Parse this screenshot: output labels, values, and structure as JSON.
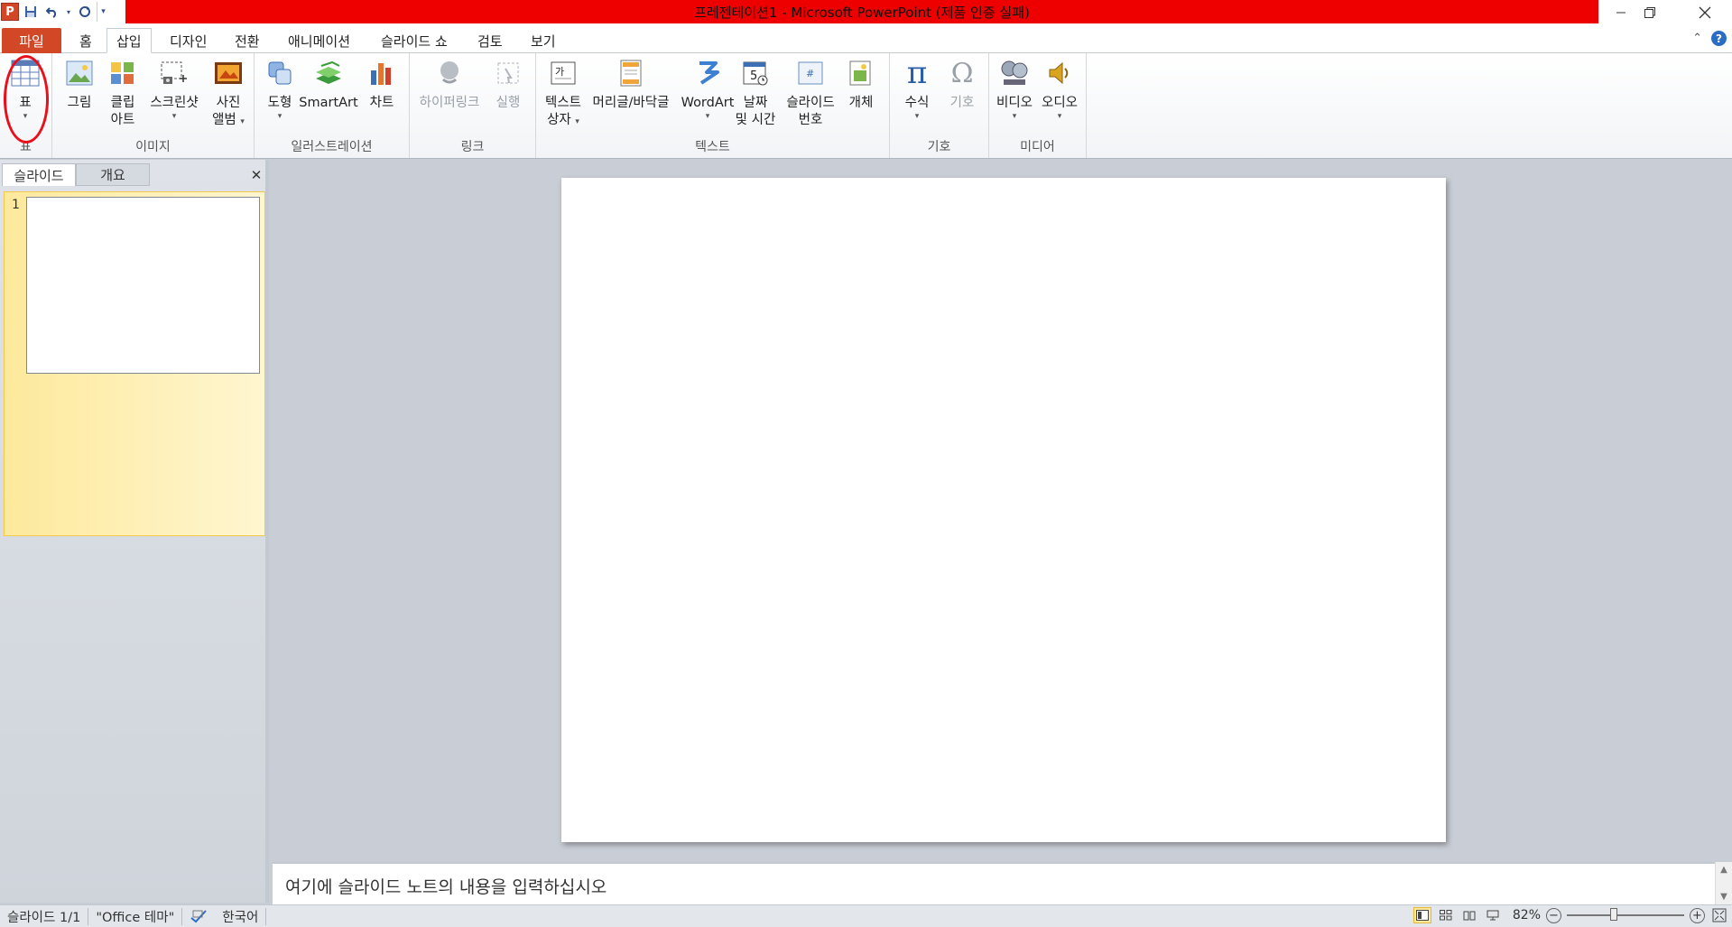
{
  "titlebar": {
    "title": "프레젠테이션1  -  Microsoft PowerPoint (제품 인증 실패)",
    "accent_color": "#ee0000"
  },
  "qat": {
    "app_icon": "powerpoint-icon",
    "app_letter": "P",
    "buttons": [
      "save-icon",
      "undo-icon",
      "redo-icon",
      "customize-dropdown-icon"
    ]
  },
  "tabs": {
    "file": "파일",
    "home": "홈",
    "insert": "삽입",
    "design": "디자인",
    "transitions": "전환",
    "animations": "애니메이션",
    "slideshow": "슬라이드 쇼",
    "review": "검토",
    "view": "보기",
    "active": "삽입"
  },
  "ribbon": {
    "groups": {
      "table": "표",
      "images": "이미지",
      "illustrations": "일러스트레이션",
      "links": "링크",
      "text": "텍스트",
      "symbols": "기호",
      "media": "미디어"
    },
    "buttons": {
      "table": "표",
      "picture": "그림",
      "clipart_1": "클립",
      "clipart_2": "아트",
      "screenshot": "스크린샷",
      "album_1": "사진",
      "album_2": "앨범",
      "shapes": "도형",
      "smartart": "SmartArt",
      "chart": "차트",
      "hyperlink": "하이퍼링크",
      "action": "실행",
      "textbox_1": "텍스트",
      "textbox_2": "상자",
      "headerfooter": "머리글/바닥글",
      "wordart": "WordArt",
      "datetime_1": "날짜",
      "datetime_2": "및 시간",
      "slidenum_1": "슬라이드",
      "slidenum_2": "번호",
      "object": "개체",
      "equation": "수식",
      "symbol": "기호",
      "video": "비디오",
      "audio": "오디오"
    }
  },
  "leftpane": {
    "tab_slides": "슬라이드",
    "tab_outline": "개요",
    "close": "✕",
    "slide_number": "1"
  },
  "notes": {
    "placeholder": "여기에 슬라이드 노트의 내용을 입력하십시오"
  },
  "statusbar": {
    "slide_info": "슬라이드 1/1",
    "theme": "\"Office 테마\"",
    "language": "한국어",
    "zoom": "82%",
    "zoom_value": 0.82
  }
}
